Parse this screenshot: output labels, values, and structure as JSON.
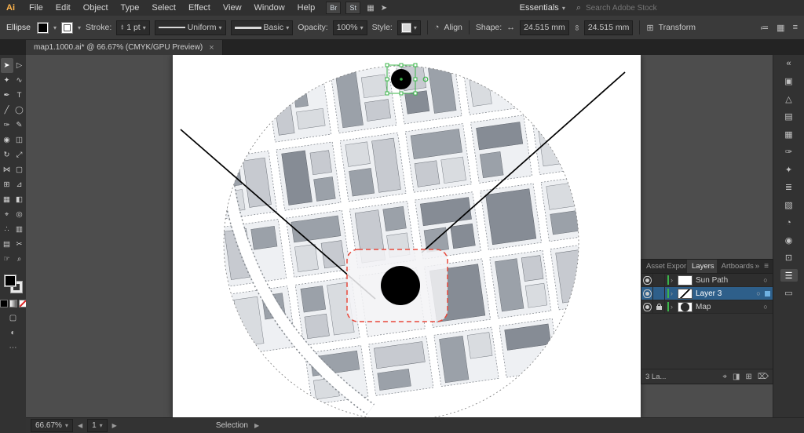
{
  "colors": {
    "selection_green": "#3bb54a",
    "site_red": "#e8483b",
    "selected_row_blue": "#2e5f8a"
  },
  "menubar": {
    "app_badge": "Ai",
    "items": [
      "File",
      "Edit",
      "Object",
      "Type",
      "Select",
      "Effect",
      "View",
      "Window",
      "Help"
    ],
    "bridge_badge": "Br",
    "stock_badge": "St",
    "workspace_label": "Essentials",
    "search_placeholder": "Search Adobe Stock"
  },
  "controlbar": {
    "tool_context": "Ellipse",
    "stroke_label": "Stroke:",
    "stroke_value": "1 pt",
    "width_profile": "Uniform",
    "brush": "Basic",
    "opacity_label": "Opacity:",
    "opacity_value": "100%",
    "style_label": "Style:",
    "align_label": "Align",
    "shape_label": "Shape:",
    "shape_width": "24.515 mm",
    "shape_height": "24.515 mm",
    "transform_label": "Transform"
  },
  "tabbar": {
    "document_title": "map1.1000.ai* @ 66.67% (CMYK/GPU Preview)",
    "close_glyph": "×"
  },
  "tools": [
    {
      "name": "selection",
      "glyph": "➤"
    },
    {
      "name": "direct-selection",
      "glyph": "▷"
    },
    {
      "name": "magic-wand",
      "glyph": "✦"
    },
    {
      "name": "lasso",
      "glyph": "∿"
    },
    {
      "name": "pen",
      "glyph": "✒"
    },
    {
      "name": "type",
      "glyph": "T"
    },
    {
      "name": "line-segment",
      "glyph": "╱"
    },
    {
      "name": "ellipse",
      "glyph": "◯"
    },
    {
      "name": "paintbrush",
      "glyph": "✑"
    },
    {
      "name": "pencil",
      "glyph": "✎"
    },
    {
      "name": "blob-brush",
      "glyph": "◉"
    },
    {
      "name": "eraser",
      "glyph": "◫"
    },
    {
      "name": "rotate",
      "glyph": "↻"
    },
    {
      "name": "scale",
      "glyph": "⤢"
    },
    {
      "name": "width",
      "glyph": "⋈"
    },
    {
      "name": "free-transform",
      "glyph": "▢"
    },
    {
      "name": "shape-builder",
      "glyph": "⊞"
    },
    {
      "name": "perspective-grid",
      "glyph": "⊿"
    },
    {
      "name": "mesh",
      "glyph": "▦"
    },
    {
      "name": "gradient",
      "glyph": "◧"
    },
    {
      "name": "eyedropper",
      "glyph": "⌖"
    },
    {
      "name": "blend",
      "glyph": "◎"
    },
    {
      "name": "symbol-sprayer",
      "glyph": "∴"
    },
    {
      "name": "column-graph",
      "glyph": "▥"
    },
    {
      "name": "artboard",
      "glyph": "▤"
    },
    {
      "name": "slice",
      "glyph": "✂"
    },
    {
      "name": "hand",
      "glyph": "☞"
    },
    {
      "name": "zoom",
      "glyph": "⌕"
    }
  ],
  "toolbar_extra": {
    "draw_mode": "▢",
    "screen_mode": "◐",
    "edit_toolbar": "⋯"
  },
  "right_strip": [
    {
      "name": "collapse-panels",
      "glyph": "«"
    },
    {
      "name": "color-panel",
      "glyph": "▣"
    },
    {
      "name": "color-guide",
      "glyph": "△"
    },
    {
      "name": "libraries",
      "glyph": "▤"
    },
    {
      "name": "swatches",
      "glyph": "▦"
    },
    {
      "name": "brushes",
      "glyph": "✑"
    },
    {
      "name": "symbols",
      "glyph": "✦"
    },
    {
      "name": "stroke-panel",
      "glyph": "≣"
    },
    {
      "name": "gradient-panel",
      "glyph": "▧"
    },
    {
      "name": "transparency",
      "glyph": "◔"
    },
    {
      "name": "appearance",
      "glyph": "◉"
    },
    {
      "name": "graphic-styles",
      "glyph": "⊡"
    },
    {
      "name": "layers",
      "glyph": "☰"
    },
    {
      "name": "artboards",
      "glyph": "▭"
    }
  ],
  "layers_panel": {
    "tabs": [
      "Asset Expor",
      "Layers",
      "Artboards"
    ],
    "more_glyph": "»",
    "menu_glyph": "≡",
    "layers": [
      {
        "name": "Sun Path"
      },
      {
        "name": "Layer 3"
      },
      {
        "name": "Map"
      }
    ],
    "status_text": "3 La...",
    "target_glyph": "○"
  },
  "statusbar": {
    "zoom_value": "66.67%",
    "artboard_number": "1",
    "status_label": "Selection"
  },
  "icons": {
    "caret": "▾",
    "caret_left": "◀",
    "caret_right": "▶",
    "play": "▶",
    "search": "⌕",
    "link": "∞",
    "width_arrow": "↔",
    "grid": "▦",
    "share": "➤",
    "recolor": "◔",
    "sliders": "≔",
    "menu": "≡",
    "disclosure": "›",
    "locate": "⌖",
    "mask": "◨",
    "new_layer": "⊞",
    "delete": "⌦",
    "transform_grid": "⊞"
  }
}
